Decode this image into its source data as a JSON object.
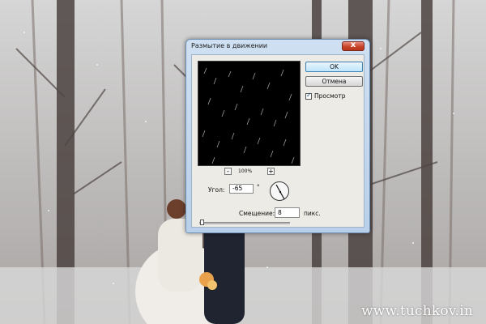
{
  "dialog": {
    "title": "Размытие в движении",
    "close_label": "x",
    "ok_label": "OK",
    "cancel_label": "Отмена",
    "preview_label": "Просмотр",
    "preview_checked": true,
    "zoom": {
      "minus": "-",
      "plus": "+",
      "level": "100%"
    },
    "angle": {
      "label": "Угол:",
      "value": "-65",
      "unit": "°"
    },
    "offset": {
      "label": "Смещение:",
      "value": "8",
      "unit": "пикс."
    }
  },
  "watermark": "www.tuchkov.in",
  "colors": {
    "title_bar": "#b9d0ea",
    "close_button": "#c7462c",
    "dialog_body": "#ecebe6"
  }
}
